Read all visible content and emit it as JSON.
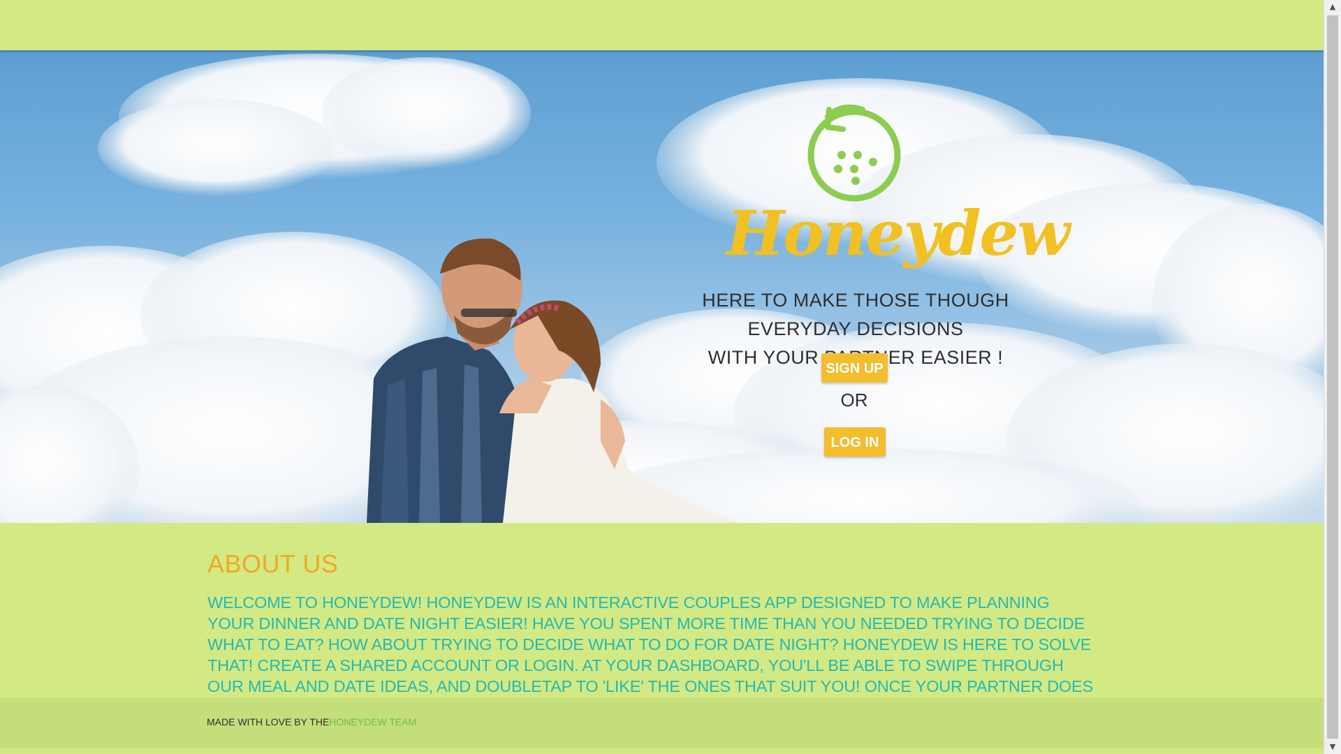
{
  "hero": {
    "brand": "Honeydew",
    "tagline_line1": "HERE TO MAKE THOSE THOUGH EVERYDAY DECISIONS",
    "tagline_line2": "WITH YOUR PARTNER EASIER !",
    "signup_label": "SIGN UP",
    "or_label": "OR",
    "login_label": "LOG IN"
  },
  "about": {
    "heading": "ABOUT US",
    "body": "WELCOME TO HONEYDEW! HONEYDEW IS AN INTERACTIVE COUPLES APP DESIGNED TO MAKE PLANNING YOUR DINNER AND DATE NIGHT EASIER! HAVE YOU SPENT MORE TIME THAN YOU NEEDED TRYING TO DECIDE WHAT TO EAT? HOW ABOUT TRYING TO DECIDE WHAT TO DO FOR DATE NIGHT? HONEYDEW IS HERE TO SOLVE THAT! CREATE A SHARED ACCOUNT OR LOGIN. AT YOUR DASHBOARD, YOU'LL BE ABLE TO SWIPE THROUGH OUR MEAL AND DATE IDEAS, AND DOUBLETAP TO 'LIKE' THE ONES THAT SUIT YOU! ONCE YOUR PARTNER DOES THE SAME, WE'LL SHOW YOU WHAT YOU BOTH LIKED!"
  },
  "footer": {
    "prefix": "MADE WITH LOVE BY THE",
    "link": "HONEYDEW TEAM"
  },
  "icons": {
    "logo": "melon-logo-icon",
    "scroll_up": "scroll-up-arrow-icon",
    "scroll_down": "scroll-down-arrow-icon"
  },
  "colors": {
    "background": "#d3ea84",
    "brand": "#f2c121",
    "button": "#f3bd2e",
    "about_heading": "#f5a623",
    "about_text": "#23b9b3",
    "logo": "#8ccd4f",
    "footer_link": "#6bbf3e"
  }
}
